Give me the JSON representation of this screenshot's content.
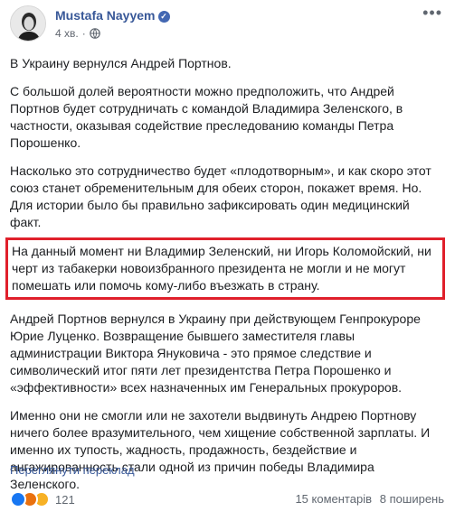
{
  "post": {
    "author": "Mustafa Nayyem",
    "time": "4 хв.",
    "paragraphs": [
      "В Украину вернулся Андрей Портнов.",
      "С большой долей вероятности можно предположить, что Андрей Портнов будет сотрудничать с командой Владимира Зеленского, в частности, оказывая содействие преследованию команды Петра Порошенко.",
      "Насколько это сотрудничество будет «плодотворным», и как скоро этот союз станет обременительным для обеих сторон, покажет время. Но. Для истории было бы правильно зафиксировать один медицинский факт.",
      "На данный момент ни Владимир Зеленский, ни Игорь Коломойский, ни черт из табакерки новоизбранного президента не могли и не могут помешать или помочь кому-либо въезжать в страну.",
      "Андрей Портнов вернулся в Украину при действующем Генпрокуроре Юрие Луценко. Возвращение бывшего заместителя главы администрации Виктора Януковича - это прямое следствие и символический итог пяти лет президентства Петра Порошенко и «эффективности» всех назначенных им Генеральных прокуроров.",
      "Именно они не смогли или не захотели выдвинуть Андрею Портнову ничего более вразумительного, чем хищение собственной зарплаты. И именно их тупость, жадность, продажность, бездействие и ангажированность стали одной из причин победы Владимира Зеленского."
    ],
    "translate_link": "Переглянути переклад",
    "reactions_count": "121",
    "comments": "15 коментарів",
    "shares": "8 поширень"
  },
  "colors": {
    "link": "#385898",
    "highlight_border": "#e0202b"
  },
  "icons": {
    "verified": "verified-badge-icon",
    "audience": "globe-icon",
    "more": "more-options-icon"
  }
}
